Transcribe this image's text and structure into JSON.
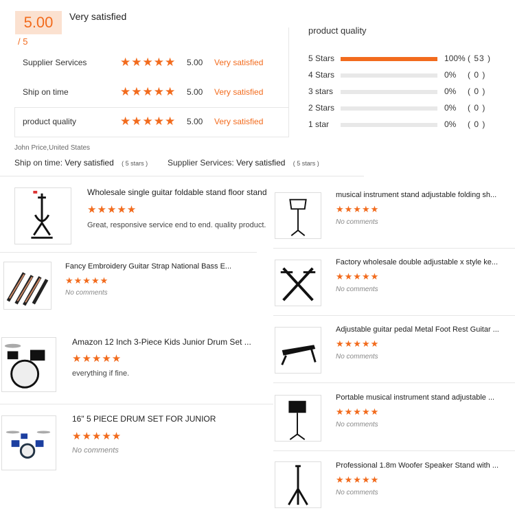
{
  "summary": {
    "score": "5.00",
    "out_of": "/ 5",
    "verdict": "Very satisfied"
  },
  "metrics": [
    {
      "label": "Supplier Services",
      "score": "5.00",
      "verdict": "Very satisfied"
    },
    {
      "label": "Ship on time",
      "score": "5.00",
      "verdict": "Very satisfied"
    },
    {
      "label": "product quality",
      "score": "5.00",
      "verdict": "Very satisfied"
    }
  ],
  "distribution": {
    "title": "product quality",
    "rows": [
      {
        "label": "5 Stars",
        "percent": "100%",
        "count": "( 53 )",
        "fill": 1.0
      },
      {
        "label": "4 Stars",
        "percent": "0%",
        "count": "( 0 )",
        "fill": 0
      },
      {
        "label": "3 stars",
        "percent": "0%",
        "count": "( 0 )",
        "fill": 0
      },
      {
        "label": "2 Stars",
        "percent": "0%",
        "count": "( 0 )",
        "fill": 0
      },
      {
        "label": "1  star",
        "percent": "0%",
        "count": "( 0 )",
        "fill": 0
      }
    ]
  },
  "review": {
    "reviewer": "John Price,United States",
    "ship_label": "Ship on time:",
    "ship_value": "Very satisfied",
    "ship_stars": "( 5 stars )",
    "supplier_label": "Supplier Services:",
    "supplier_value": "Very satisfied",
    "supplier_stars": "( 5 stars )"
  },
  "star_glyph": "★★★★★",
  "products_left": [
    {
      "title": "Wholesale single guitar foldable stand floor stand",
      "comment": "Great, responsive service end to end. quality product.",
      "icon": "guitar-stand-icon"
    },
    {
      "title": "Fancy Embroidery Guitar Strap National Bass E...",
      "comment": "No comments",
      "icon": "guitar-strap-icon"
    },
    {
      "title": "Amazon 12 Inch 3-Piece Kids Junior Drum Set ...",
      "comment": "everything if fine.",
      "icon": "drum-set-icon"
    },
    {
      "title": "16\" 5 PIECE DRUM SET FOR JUNIOR",
      "comment": "No comments",
      "icon": "junior-drum-set-icon"
    }
  ],
  "products_right": [
    {
      "title": "musical instrument stand adjustable folding sh...",
      "comment": "No comments",
      "icon": "music-stand-icon"
    },
    {
      "title": "Factory wholesale double adjustable x style ke...",
      "comment": "No comments",
      "icon": "keyboard-stand-icon"
    },
    {
      "title": "Adjustable guitar pedal Metal Foot Rest Guitar ...",
      "comment": "No comments",
      "icon": "foot-rest-icon"
    },
    {
      "title": "Portable musical instrument stand adjustable ...",
      "comment": "No comments",
      "icon": "sheet-music-stand-icon"
    },
    {
      "title": "Professional 1.8m Woofer Speaker Stand with ...",
      "comment": "No comments",
      "icon": "speaker-stand-icon"
    }
  ],
  "colors": {
    "accent": "#f26b1d",
    "score_bg": "#fbe1d0"
  }
}
